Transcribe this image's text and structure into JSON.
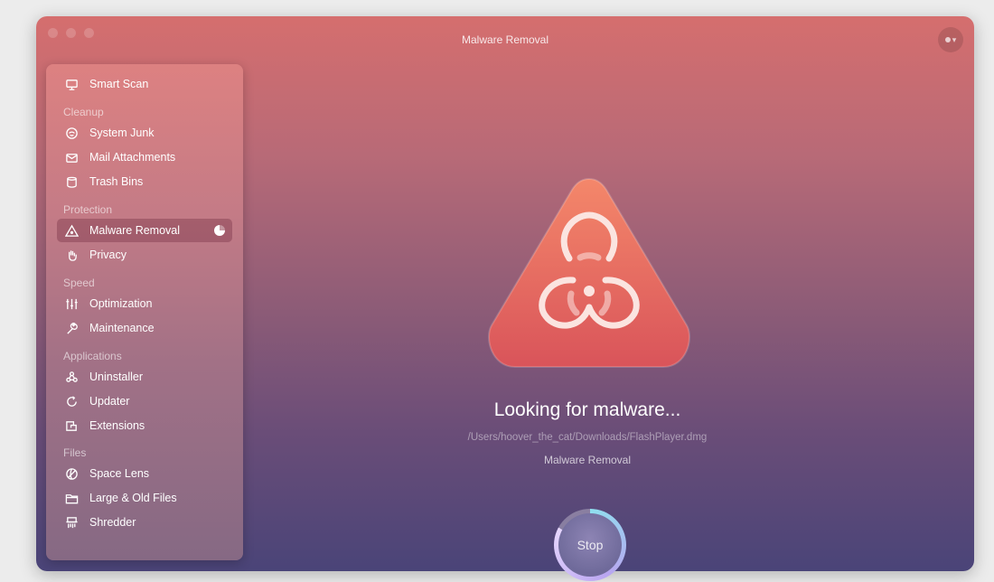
{
  "window": {
    "title": "Malware Removal"
  },
  "sidebar": {
    "items": [
      {
        "key": "smart-scan",
        "label": "Smart Scan",
        "icon": "monitor-icon"
      },
      {
        "key": "system-junk",
        "label": "System Junk",
        "icon": "junk-icon"
      },
      {
        "key": "mail-attachments",
        "label": "Mail Attachments",
        "icon": "mail-icon"
      },
      {
        "key": "trash-bins",
        "label": "Trash Bins",
        "icon": "trash-icon"
      },
      {
        "key": "malware-removal",
        "label": "Malware Removal",
        "icon": "biohazard-icon",
        "active": true
      },
      {
        "key": "privacy",
        "label": "Privacy",
        "icon": "hand-icon"
      },
      {
        "key": "optimization",
        "label": "Optimization",
        "icon": "sliders-icon"
      },
      {
        "key": "maintenance",
        "label": "Maintenance",
        "icon": "wrench-icon"
      },
      {
        "key": "uninstaller",
        "label": "Uninstaller",
        "icon": "uninstaller-icon"
      },
      {
        "key": "updater",
        "label": "Updater",
        "icon": "updater-icon"
      },
      {
        "key": "extensions",
        "label": "Extensions",
        "icon": "extensions-icon"
      },
      {
        "key": "space-lens",
        "label": "Space Lens",
        "icon": "lens-icon"
      },
      {
        "key": "large-old-files",
        "label": "Large & Old Files",
        "icon": "folder-icon"
      },
      {
        "key": "shredder",
        "label": "Shredder",
        "icon": "shredder-icon"
      }
    ],
    "sections": {
      "cleanup": "Cleanup",
      "protection": "Protection",
      "speed": "Speed",
      "applications": "Applications",
      "files": "Files"
    },
    "active_progress": 0.75
  },
  "main": {
    "status_title": "Looking for malware...",
    "scan_path": "/Users/hoover_the_cat/Downloads/FlashPlayer.dmg",
    "module_name": "Malware Removal",
    "hero_icon": "biohazard-icon",
    "stop_label": "Stop",
    "scan_progress": 0.83
  },
  "colors": {
    "accent": "#e8706a",
    "background_top": "#d56e6e",
    "background_bottom": "#4a4478"
  }
}
